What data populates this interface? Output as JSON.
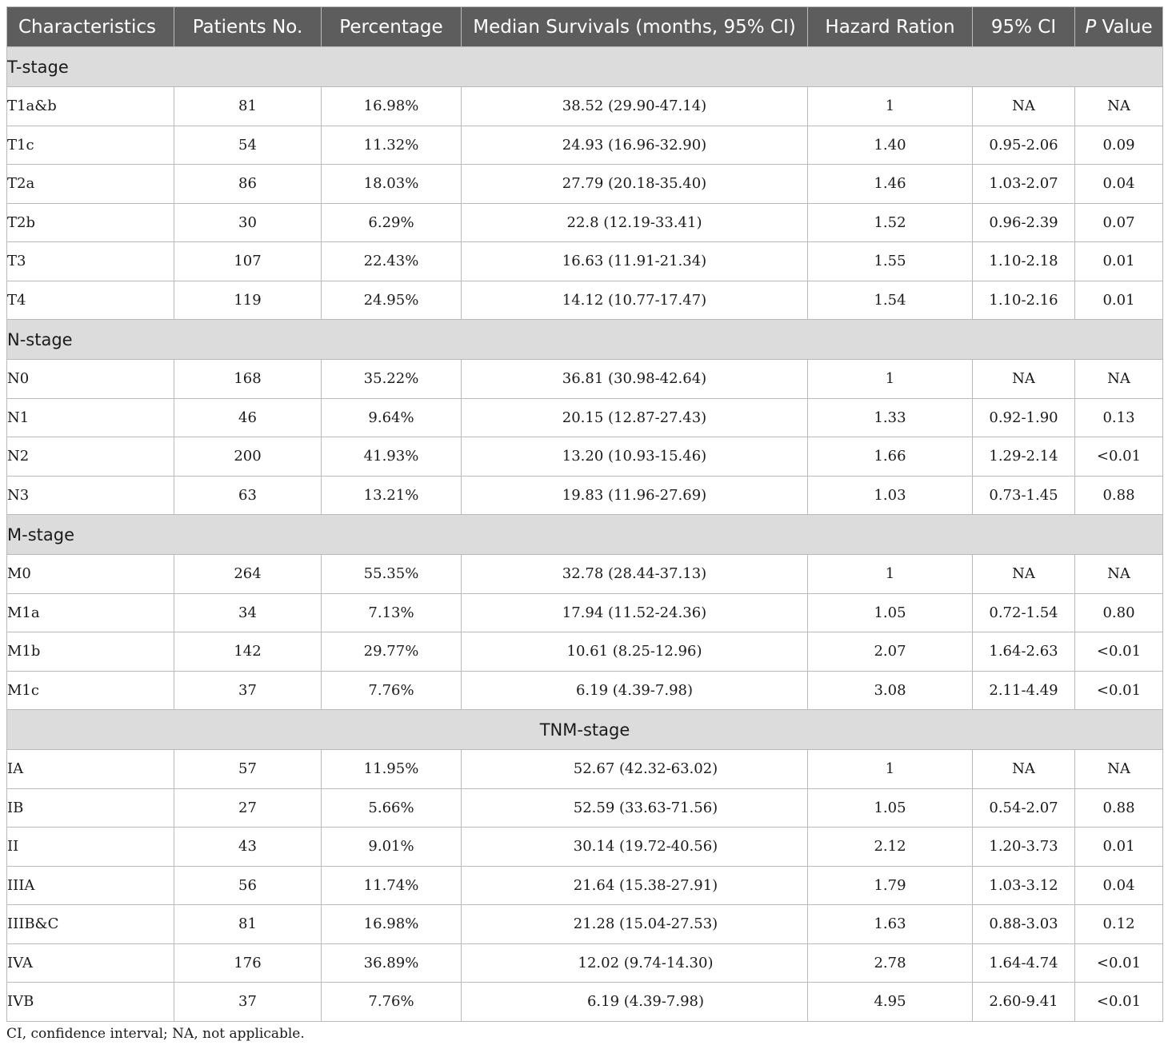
{
  "columns": [
    "Characteristics",
    "Patients No.",
    "Percentage",
    "Median Survivals (months, 95% CI)",
    "Hazard Ration",
    "95% CI",
    "P",
    " Value"
  ],
  "groups": [
    {
      "title": "T-stage",
      "rows": [
        [
          "T1a&b",
          "81",
          "16.98%",
          "38.52 (29.90-47.14)",
          "1",
          "NA",
          "NA"
        ],
        [
          "T1c",
          "54",
          "11.32%",
          "24.93 (16.96-32.90)",
          "1.40",
          "0.95-2.06",
          "0.09"
        ],
        [
          "T2a",
          "86",
          "18.03%",
          "27.79 (20.18-35.40)",
          "1.46",
          "1.03-2.07",
          "0.04"
        ],
        [
          "T2b",
          "30",
          "6.29%",
          "22.8 (12.19-33.41)",
          "1.52",
          "0.96-2.39",
          "0.07"
        ],
        [
          "T3",
          "107",
          "22.43%",
          "16.63 (11.91-21.34)",
          "1.55",
          "1.10-2.18",
          "0.01"
        ],
        [
          "T4",
          "119",
          "24.95%",
          "14.12 (10.77-17.47)",
          "1.54",
          "1.10-2.16",
          "0.01"
        ]
      ]
    },
    {
      "title": "N-stage",
      "rows": [
        [
          "N0",
          "168",
          "35.22%",
          "36.81 (30.98-42.64)",
          "1",
          "NA",
          "NA"
        ],
        [
          "N1",
          "46",
          "9.64%",
          "20.15 (12.87-27.43)",
          "1.33",
          "0.92-1.90",
          "0.13"
        ],
        [
          "N2",
          "200",
          "41.93%",
          "13.20 (10.93-15.46)",
          "1.66",
          "1.29-2.14",
          "<0.01"
        ],
        [
          "N3",
          "63",
          "13.21%",
          "19.83 (11.96-27.69)",
          "1.03",
          "0.73-1.45",
          "0.88"
        ]
      ]
    },
    {
      "title": "M-stage",
      "rows": [
        [
          "M0",
          "264",
          "55.35%",
          "32.78 (28.44-37.13)",
          "1",
          "NA",
          "NA"
        ],
        [
          "M1a",
          "34",
          "7.13%",
          "17.94 (11.52-24.36)",
          "1.05",
          "0.72-1.54",
          "0.80"
        ],
        [
          "M1b",
          "142",
          "29.77%",
          "10.61 (8.25-12.96)",
          "2.07",
          "1.64-2.63",
          "<0.01"
        ],
        [
          "M1c",
          "37",
          "7.76%",
          "6.19 (4.39-7.98)",
          "3.08",
          "2.11-4.49",
          "<0.01"
        ]
      ]
    },
    {
      "title": "TNM-stage",
      "rows": [
        [
          "IA",
          "57",
          "11.95%",
          "52.67 (42.32-63.02)",
          "1",
          "NA",
          "NA"
        ],
        [
          "IB",
          "27",
          "5.66%",
          "52.59 (33.63-71.56)",
          "1.05",
          "0.54-2.07",
          "0.88"
        ],
        [
          "II",
          "43",
          "9.01%",
          "30.14 (19.72-40.56)",
          "2.12",
          "1.20-3.73",
          "0.01"
        ],
        [
          "IIIA",
          "56",
          "11.74%",
          "21.64 (15.38-27.91)",
          "1.79",
          "1.03-3.12",
          "0.04"
        ],
        [
          "IIIB&C",
          "81",
          "16.98%",
          "21.28 (15.04-27.53)",
          "1.63",
          "0.88-3.03",
          "0.12"
        ],
        [
          "IVA",
          "176",
          "36.89%",
          "12.02 (9.74-14.30)",
          "2.78",
          "1.64-4.74",
          "<0.01"
        ],
        [
          "IVB",
          "37",
          "7.76%",
          "6.19 (4.39-7.98)",
          "4.95",
          "2.60-9.41",
          "<0.01"
        ]
      ]
    }
  ],
  "footnote": "CI, confidence interval; NA, not applicable."
}
